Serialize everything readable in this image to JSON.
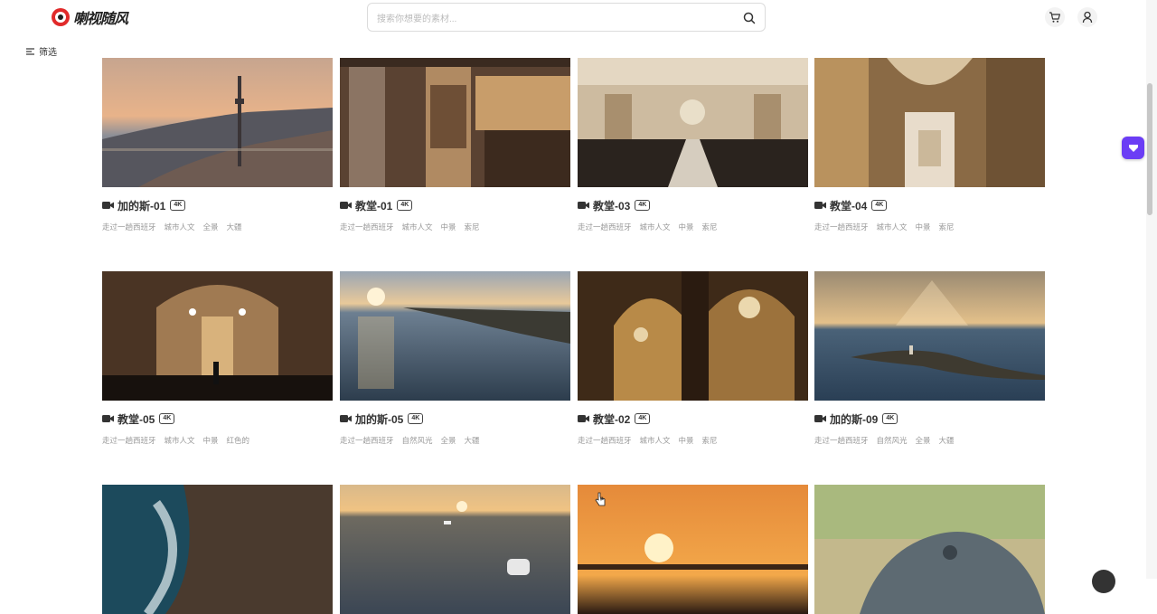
{
  "header": {
    "logo_text": "喇视随风",
    "search_placeholder": "搜索你想要的素材..."
  },
  "icons": {
    "search": "search-icon",
    "cart": "cart-icon",
    "user": "user-icon",
    "filter": "filter-icon",
    "camera": "video-camera-icon",
    "widget": "gift-icon"
  },
  "filter": {
    "label": "筛选"
  },
  "colors": {
    "accent": "#6b3df5",
    "logo": "#e12a2a",
    "tag": "#999999"
  },
  "cards": [
    {
      "title": "加的斯-01",
      "badge": "4K",
      "tags": [
        "走过一趟西班牙",
        "城市人文",
        "全景",
        "大疆"
      ],
      "scene": "coast-dusk"
    },
    {
      "title": "教堂-01",
      "badge": "4K",
      "tags": [
        "走过一趟西班牙",
        "城市人文",
        "中景",
        "索尼"
      ],
      "scene": "organ"
    },
    {
      "title": "教堂-03",
      "badge": "4K",
      "tags": [
        "走过一趟西班牙",
        "城市人文",
        "中景",
        "索尼"
      ],
      "scene": "nave"
    },
    {
      "title": "教堂-04",
      "badge": "4K",
      "tags": [
        "走过一趟西班牙",
        "城市人文",
        "中景",
        "索尼"
      ],
      "scene": "columns"
    },
    {
      "title": "教堂-05",
      "badge": "4K",
      "tags": [
        "走过一趟西班牙",
        "城市人文",
        "中景",
        "红色的"
      ],
      "scene": "interior-dark"
    },
    {
      "title": "加的斯-05",
      "badge": "4K",
      "tags": [
        "走过一趟西班牙",
        "自然风光",
        "全景",
        "大疆"
      ],
      "scene": "sea-sunset"
    },
    {
      "title": "教堂-02",
      "badge": "4K",
      "tags": [
        "走过一趟西班牙",
        "城市人文",
        "中景",
        "索尼"
      ],
      "scene": "arch"
    },
    {
      "title": "加的斯-09",
      "badge": "4K",
      "tags": [
        "走过一趟西班牙",
        "自然风光",
        "全景",
        "大疆"
      ],
      "scene": "sea-rays"
    },
    {
      "title": "",
      "badge": "",
      "tags": [],
      "scene": "rocks-sea"
    },
    {
      "title": "",
      "badge": "",
      "tags": [],
      "scene": "boats-sunset"
    },
    {
      "title": "",
      "badge": "",
      "tags": [],
      "scene": "sun-orange"
    },
    {
      "title": "",
      "badge": "",
      "tags": [],
      "scene": "lizard"
    }
  ]
}
